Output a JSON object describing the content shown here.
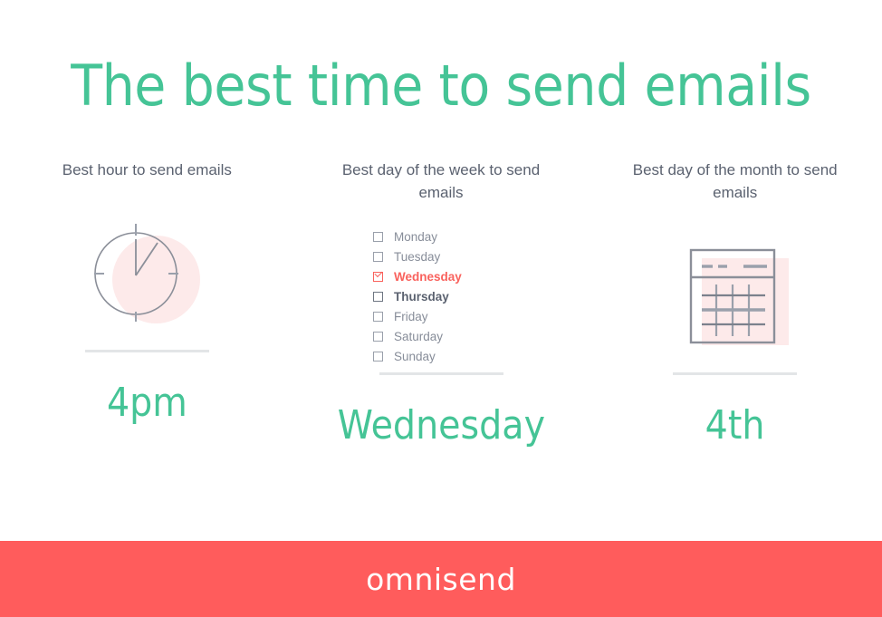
{
  "title": "The best time to send emails",
  "colors": {
    "accent_green": "#45c496",
    "coral": "#ff5c5c",
    "blush": "#fdeaea",
    "header_gray": "#5b6270",
    "muted_gray": "#878d99",
    "divider": "#e3e5e7"
  },
  "columns": [
    {
      "header": "Best hour to send emails",
      "icon": "clock-icon",
      "answer": "4pm"
    },
    {
      "header": "Best day of the week to send emails",
      "icon": "checkbox-list",
      "answer": "Wednesday",
      "days": [
        {
          "label": "Monday",
          "checked": false,
          "emphasis": "normal"
        },
        {
          "label": "Tuesday",
          "checked": false,
          "emphasis": "normal"
        },
        {
          "label": "Wednesday",
          "checked": true,
          "emphasis": "checked"
        },
        {
          "label": "Thursday",
          "checked": false,
          "emphasis": "bold"
        },
        {
          "label": "Friday",
          "checked": false,
          "emphasis": "normal"
        },
        {
          "label": "Saturday",
          "checked": false,
          "emphasis": "normal"
        },
        {
          "label": "Sunday",
          "checked": false,
          "emphasis": "normal"
        }
      ]
    },
    {
      "header": "Best day of the month to send emails",
      "icon": "calendar-icon",
      "answer": "4th"
    }
  ],
  "footer": {
    "brand": "omnisend"
  }
}
